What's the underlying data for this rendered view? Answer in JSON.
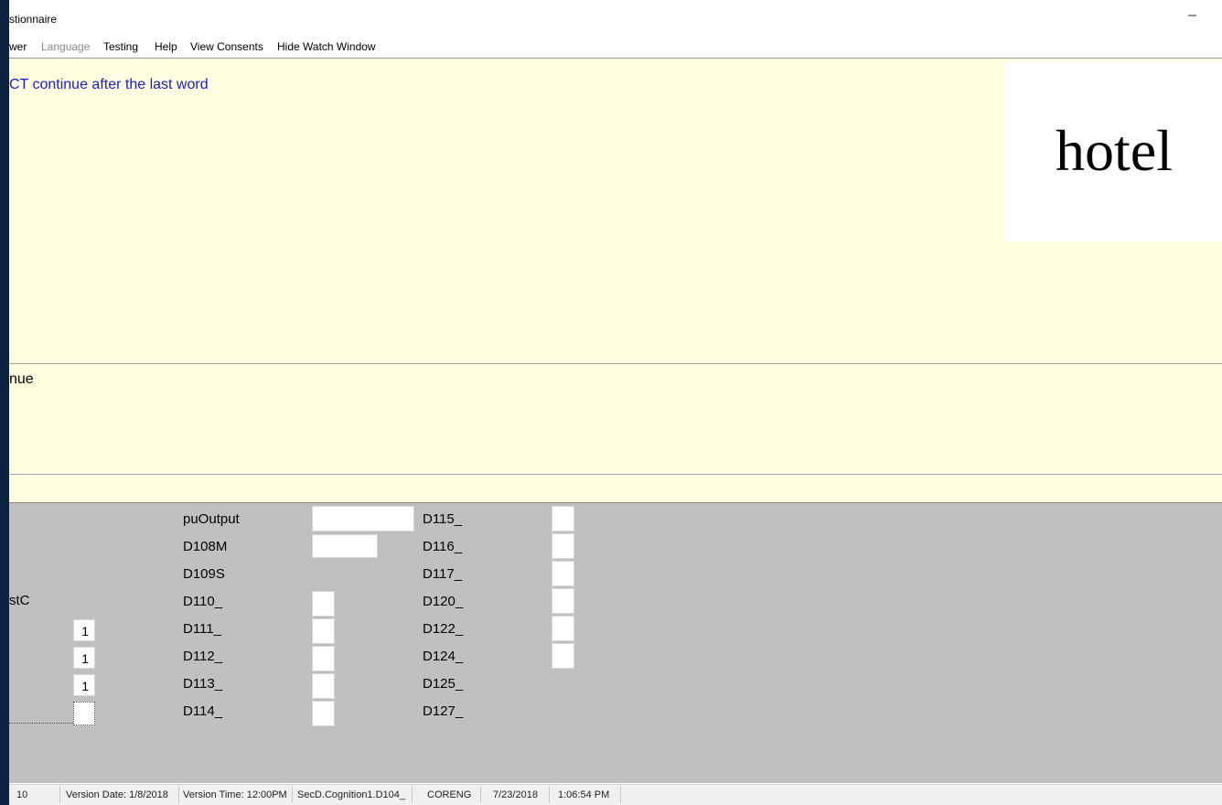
{
  "window": {
    "title": "stionnaire",
    "minimize_glyph": "–"
  },
  "menu": [
    {
      "label": "wer",
      "enabled": true
    },
    {
      "label": "Language",
      "enabled": false
    },
    {
      "label": "Testing",
      "enabled": true
    },
    {
      "label": "Help",
      "enabled": true
    },
    {
      "label": "View Consents",
      "enabled": true
    },
    {
      "label": "Hide Watch Window",
      "enabled": true
    }
  ],
  "question": {
    "instruction": "CT continue after the last word",
    "word": "hotel"
  },
  "answer": {
    "text": "nue"
  },
  "watch": {
    "left_label": "stC",
    "left_values": [
      "1",
      "1",
      "1",
      ""
    ],
    "col2": [
      "puOutput",
      "D108M",
      "D109S",
      "D110_",
      "D111_",
      "D112_",
      "D113_",
      "D114_"
    ],
    "col2_values": [
      "",
      "",
      "",
      "",
      "",
      "",
      "",
      ""
    ],
    "col3": [
      "D115_",
      "D116_",
      "D117_",
      "D120_",
      "D122_",
      "D124_",
      "D125_",
      "D127_"
    ],
    "col3_values": [
      "",
      "",
      "",
      "",
      "",
      ""
    ]
  },
  "status": {
    "field1": "10",
    "version_date": "Version Date: 1/8/2018",
    "version_time": "Version Time: 12:00PM",
    "field_name": "SecD.Cognition1.D104_",
    "instrument": "CORENG",
    "date": "7/23/2018",
    "time": "1:06:54 PM"
  },
  "colors": {
    "panel_bg": "#fffee0",
    "watch_bg": "#c0c0c0",
    "instruction_text": "#1a1acd"
  }
}
